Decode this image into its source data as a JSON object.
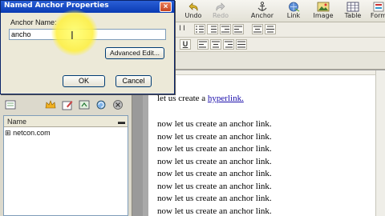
{
  "dialog": {
    "title": "Named Anchor Properties",
    "close_glyph": "×",
    "name_label": "Anchor Name:",
    "name_value": "ancho",
    "advanced_label": "Advanced Edit...",
    "ok_label": "OK",
    "cancel_label": "Cancel"
  },
  "toolbar": {
    "items": [
      {
        "label": "Undo",
        "icon": "undo-icon",
        "enabled": true
      },
      {
        "label": "Redo",
        "icon": "redo-icon",
        "enabled": false
      },
      {
        "label": "Anchor",
        "icon": "anchor-icon",
        "enabled": true
      },
      {
        "label": "Link",
        "icon": "link-icon",
        "enabled": true
      },
      {
        "label": "Image",
        "icon": "image-icon",
        "enabled": true
      },
      {
        "label": "Table",
        "icon": "table-icon",
        "enabled": true
      },
      {
        "label": "Form",
        "icon": "form-icon",
        "enabled": true
      }
    ]
  },
  "format": {
    "underline": "U",
    "italic_marks": "I I"
  },
  "site_panel": {
    "header": "Name",
    "item": "netcon.com",
    "expand_glyph": "⊞"
  },
  "document": {
    "first_prefix": "let us create a ",
    "first_link": "hyperlink.",
    "repeat_line": "now let us create an anchor link.",
    "repeat_count": 8
  },
  "colors": {
    "accent": "#0a3bb3",
    "highlight": "#fff04a",
    "link": "#1a0dab"
  }
}
